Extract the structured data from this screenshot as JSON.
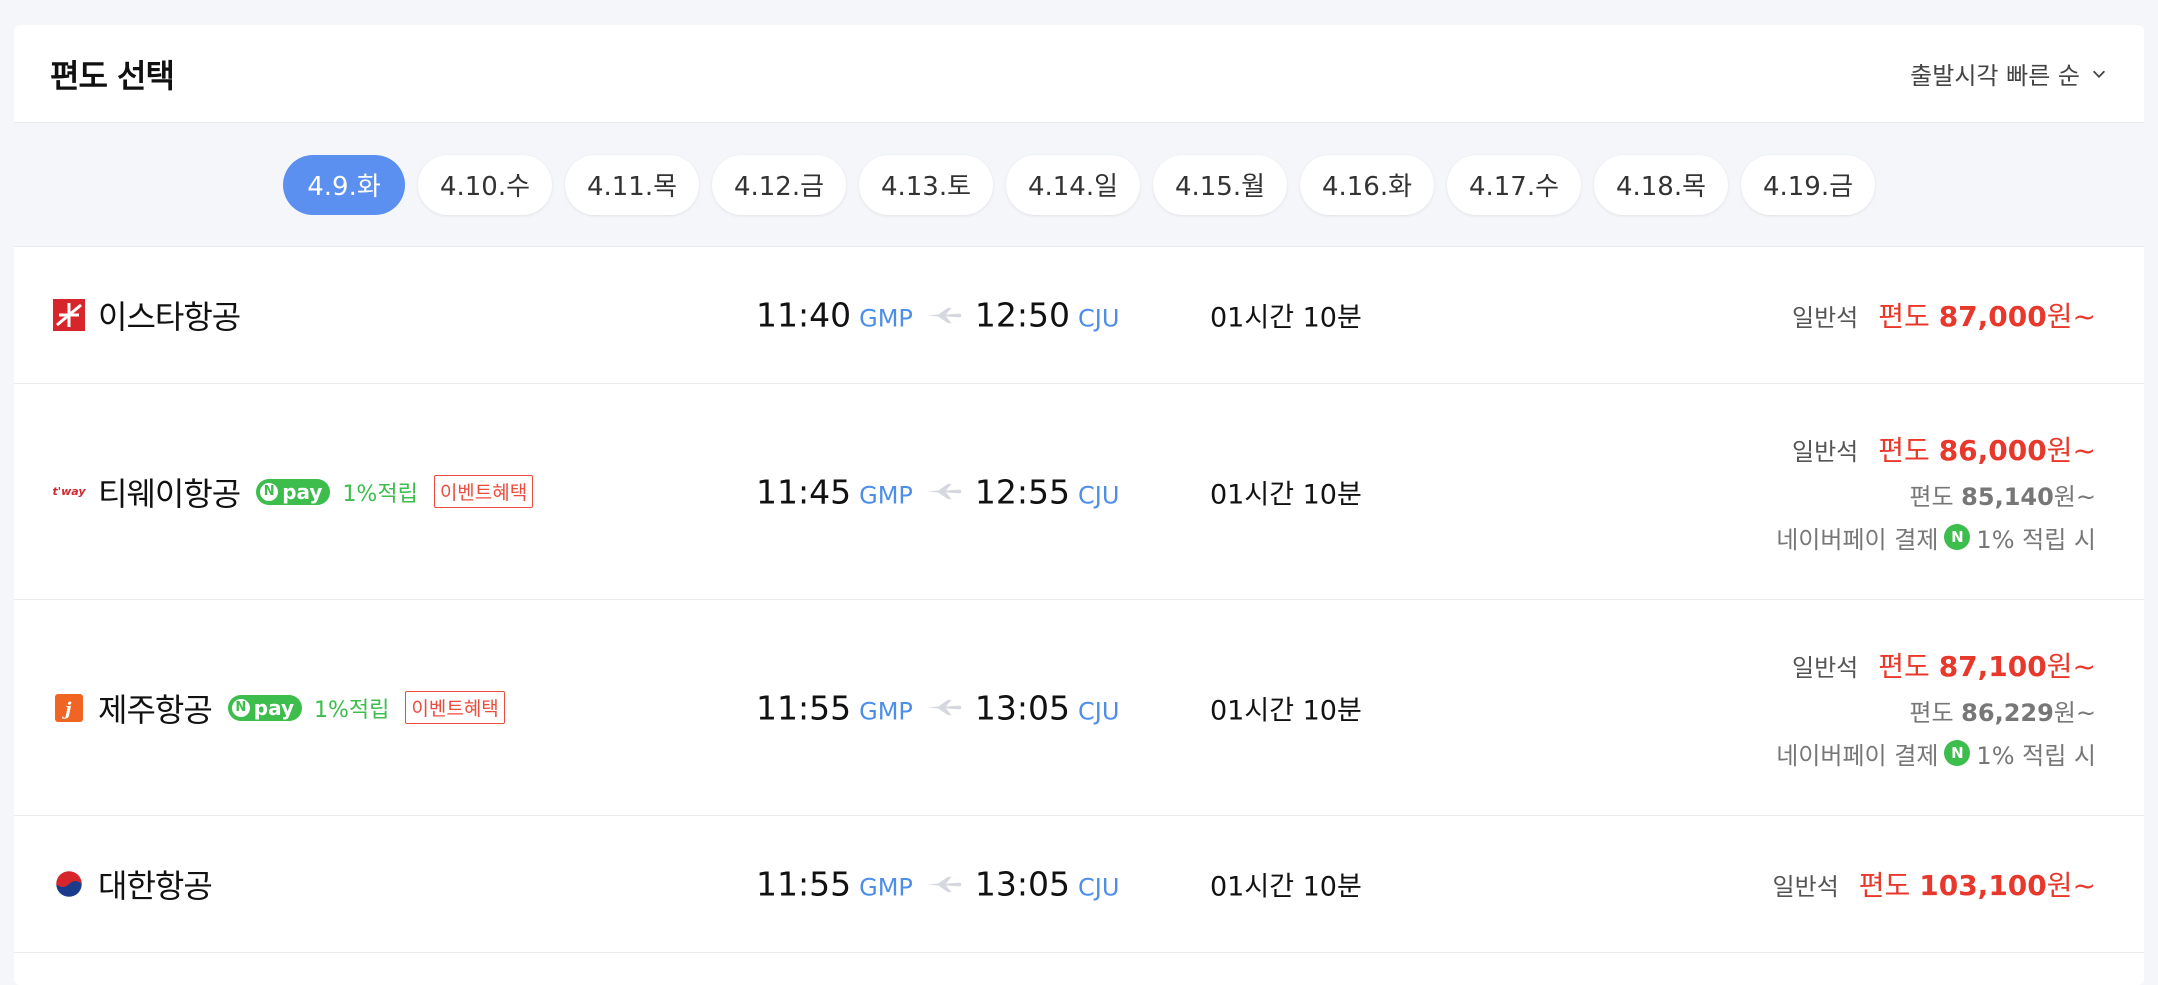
{
  "header": {
    "title": "편도 선택",
    "sort_label": "출발시각 빠른 순"
  },
  "dates": [
    "4.9.화",
    "4.10.수",
    "4.11.목",
    "4.12.금",
    "4.13.토",
    "4.14.일",
    "4.15.월",
    "4.16.화",
    "4.17.수",
    "4.18.목",
    "4.19.금"
  ],
  "selected_date": "4.9.화",
  "flights": [
    {
      "airline": "이스타항공",
      "logo_text": "",
      "dep_time": "11:40",
      "dep_code": "GMP",
      "arr_time": "12:50",
      "arr_code": "CJU",
      "duration": "01시간 10분",
      "seat": "일반석",
      "fare_prefix": "편도",
      "fare": "87,000",
      "fare_suffix": "원~"
    },
    {
      "airline": "티웨이항공",
      "logo_text": "t'way",
      "npay": "pay",
      "earn": "1%적립",
      "event": "이벤트혜택",
      "dep_time": "11:45",
      "dep_code": "GMP",
      "arr_time": "12:55",
      "arr_code": "CJU",
      "duration": "01시간 10분",
      "seat": "일반석",
      "fare_prefix": "편도",
      "fare": "86,000",
      "fare_suffix": "원~",
      "npay_fare_prefix": "편도",
      "npay_fare": "85,140",
      "npay_fare_suffix": "원~",
      "npay_note_a": "네이버페이 결제",
      "npay_note_b": "1% 적립 시"
    },
    {
      "airline": "제주항공",
      "logo_text": "j",
      "npay": "pay",
      "earn": "1%적립",
      "event": "이벤트혜택",
      "dep_time": "11:55",
      "dep_code": "GMP",
      "arr_time": "13:05",
      "arr_code": "CJU",
      "duration": "01시간 10분",
      "seat": "일반석",
      "fare_prefix": "편도",
      "fare": "87,100",
      "fare_suffix": "원~",
      "npay_fare_prefix": "편도",
      "npay_fare": "86,229",
      "npay_fare_suffix": "원~",
      "npay_note_a": "네이버페이 결제",
      "npay_note_b": "1% 적립 시"
    },
    {
      "airline": "대한항공",
      "logo_text": "",
      "dep_time": "11:55",
      "dep_code": "GMP",
      "arr_time": "13:05",
      "arr_code": "CJU",
      "duration": "01시간 10분",
      "seat": "일반석",
      "fare_prefix": "편도",
      "fare": "103,100",
      "fare_suffix": "원~"
    }
  ],
  "colors": {
    "accent": "#5b8ff0",
    "price_red": "#e8382c",
    "npay_green": "#3cbd4c",
    "code_blue": "#4d8ee8"
  }
}
